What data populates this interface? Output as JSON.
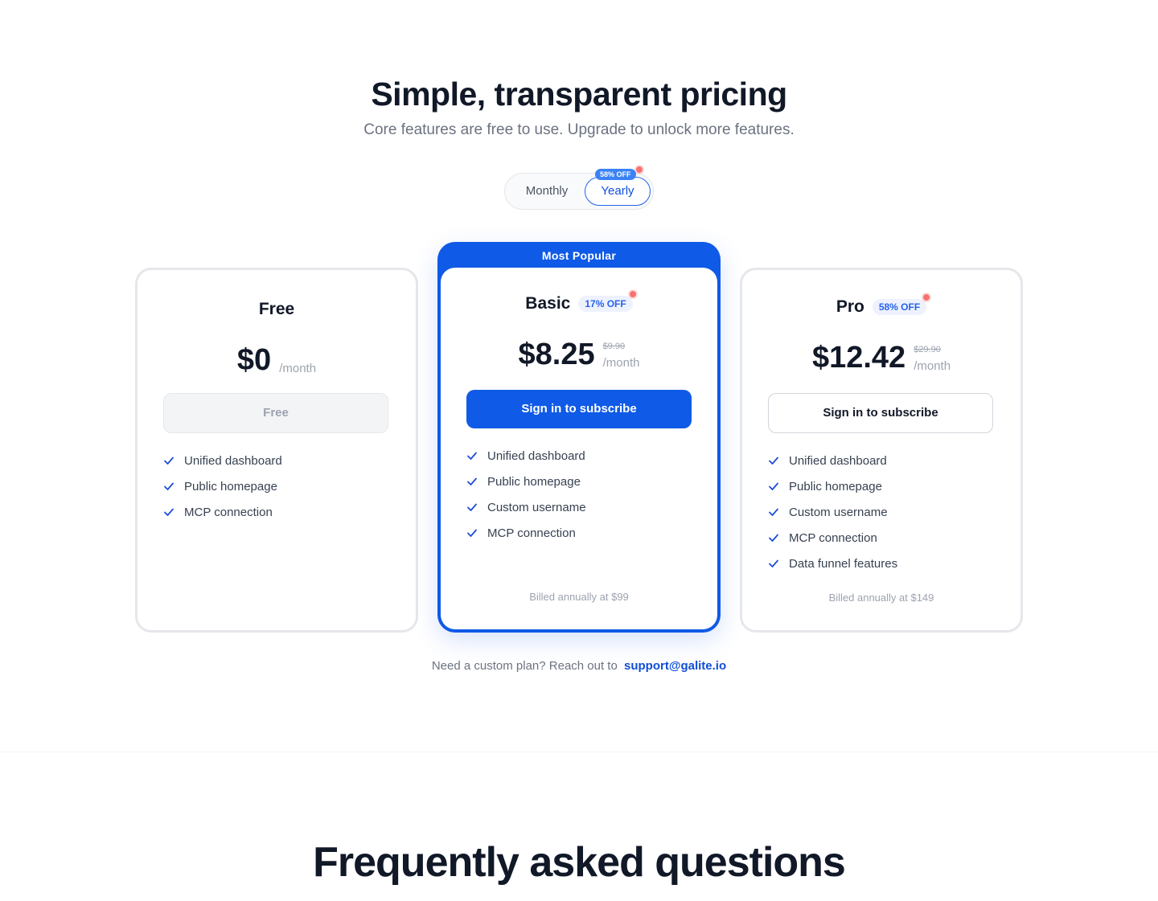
{
  "header": {
    "title": "Simple, transparent pricing",
    "subtitle": "Core features are free to use. Upgrade to unlock more features."
  },
  "billing_toggle": {
    "monthly_label": "Monthly",
    "yearly_label": "Yearly",
    "yearly_badge": "58% OFF",
    "selected": "Yearly"
  },
  "plans": {
    "free": {
      "name": "Free",
      "price": "$0",
      "unit": "/month",
      "button": "Free",
      "features": [
        "Unified dashboard",
        "Public homepage",
        "MCP connection"
      ]
    },
    "basic": {
      "ribbon": "Most Popular",
      "name": "Basic",
      "badge": "17% OFF",
      "price": "$8.25",
      "original_price": "$9.90",
      "unit": "/month",
      "button": "Sign in to subscribe",
      "features": [
        "Unified dashboard",
        "Public homepage",
        "Custom username",
        "MCP connection"
      ],
      "billed": "Billed annually at $99"
    },
    "pro": {
      "name": "Pro",
      "badge": "58% OFF",
      "price": "$12.42",
      "original_price": "$29.90",
      "unit": "/month",
      "button": "Sign in to subscribe",
      "features": [
        "Unified dashboard",
        "Public homepage",
        "Custom username",
        "MCP connection",
        "Data funnel features"
      ],
      "billed": "Billed annually at $149"
    }
  },
  "custom_plan": {
    "text": "Need a custom plan? Reach out to",
    "email": "support@galite.io"
  },
  "faq": {
    "title": "Frequently asked questions"
  },
  "colors": {
    "accent": "#0f5ae6",
    "check": "#1d4ed8",
    "notification_dot": "#f87171"
  }
}
